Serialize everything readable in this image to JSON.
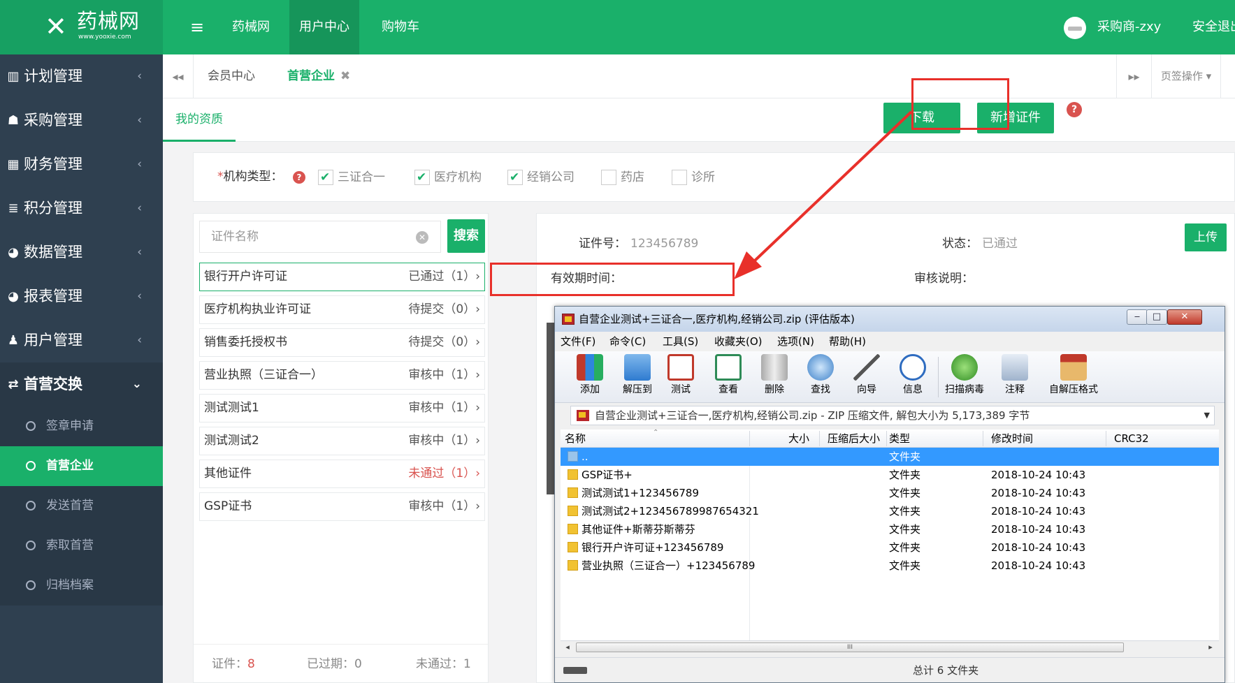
{
  "topbar": {
    "logo_mark": "✕",
    "logo_name": "药械网",
    "logo_url": "www.yooxie.com",
    "menu_icon": "hamburger-icon",
    "nav": [
      "药械网",
      "用户中心",
      "购物车"
    ],
    "user": "采购商-zxy",
    "logout": "安全退出"
  },
  "sidebar": {
    "items": [
      {
        "label": "计划管理",
        "icon": "bar-chart-icon"
      },
      {
        "label": "采购管理",
        "icon": "shopping-icon"
      },
      {
        "label": "财务管理",
        "icon": "calculator-icon"
      },
      {
        "label": "积分管理",
        "icon": "database-icon"
      },
      {
        "label": "数据管理",
        "icon": "pie-chart-icon"
      },
      {
        "label": "报表管理",
        "icon": "pie-chart-icon"
      },
      {
        "label": "用户管理",
        "icon": "user-icon"
      }
    ],
    "active_parent": {
      "label": "首营交换",
      "icon": "exchange-icon"
    },
    "submenu": [
      "签章申请",
      "首营企业",
      "发送首营",
      "索取首营",
      "归档档案"
    ],
    "submenu_active_index": 1
  },
  "tabs": {
    "items": [
      "会员中心",
      "首营企业"
    ],
    "close_glyph": "✖",
    "ops": "页签操作 ▾"
  },
  "subtab": "我的资质",
  "buttons": {
    "download": "下载",
    "new_cert": "新增证件",
    "upload": "上传",
    "search": "搜索"
  },
  "org": {
    "required_mark": "*",
    "label": "机构类型：",
    "options": [
      {
        "label": "三证合一",
        "checked": true
      },
      {
        "label": "医疗机构",
        "checked": true
      },
      {
        "label": "经销公司",
        "checked": true
      },
      {
        "label": "药店",
        "checked": false
      },
      {
        "label": "诊所",
        "checked": false
      }
    ]
  },
  "search": {
    "placeholder": "证件名称"
  },
  "certs": [
    {
      "name": "银行开户许可证",
      "status": "已通过（1）›"
    },
    {
      "name": "医疗机构执业许可证",
      "status": "待提交（0）›"
    },
    {
      "name": "销售委托授权书",
      "status": "待提交（0）›"
    },
    {
      "name": "营业执照（三证合一）",
      "status": "审核中（1）›"
    },
    {
      "name": "测试测试1",
      "status": "审核中（1）›"
    },
    {
      "name": "测试测试2",
      "status": "审核中（1）›"
    },
    {
      "name": "其他证件",
      "status": "未通过（1）›"
    },
    {
      "name": "GSP证书",
      "status": "审核中（1）›"
    }
  ],
  "footer": {
    "cert_label": "证件：",
    "cert_value": "8",
    "expired_label": "已过期：",
    "expired_value": "0",
    "failed_label": "未通过：",
    "failed_value": "1"
  },
  "detail": {
    "cert_no_label": "证件号：",
    "cert_no": "123456789",
    "status_label": "状态：",
    "status": "已通过",
    "valid_label": "有效期时间：",
    "review_label": "审核说明："
  },
  "zip": {
    "title": "自营企业测试+三证合一,医疗机构,经销公司.zip (评估版本)",
    "window_buttons": [
      "‒",
      "□",
      "✕"
    ],
    "menu": [
      "文件(F)",
      "命令(C)",
      "工具(S)",
      "收藏夹(O)",
      "选项(N)",
      "帮助(H)"
    ],
    "toolbar": [
      {
        "label": "添加",
        "icon": "add-archive-icon"
      },
      {
        "label": "解压到",
        "icon": "extract-folder-icon"
      },
      {
        "label": "测试",
        "icon": "test-clipboard-icon"
      },
      {
        "label": "查看",
        "icon": "view-book-icon"
      },
      {
        "label": "删除",
        "icon": "trash-icon"
      },
      {
        "label": "查找",
        "icon": "magnifier-icon"
      },
      {
        "label": "向导",
        "icon": "wizard-wand-icon"
      },
      {
        "label": "信息",
        "icon": "info-icon"
      },
      {
        "label": "扫描病毒",
        "icon": "virus-scan-icon"
      },
      {
        "label": "注释",
        "icon": "comment-icon"
      },
      {
        "label": "自解压格式",
        "icon": "sfx-box-icon"
      }
    ],
    "address": "自营企业测试+三证合一,医疗机构,经销公司.zip - ZIP 压缩文件, 解包大小为 5,173,389 字节",
    "headers": [
      "名称",
      "大小",
      "压缩后大小",
      "类型",
      "修改时间",
      "CRC32"
    ],
    "rows": [
      {
        "name": "..",
        "type": "文件夹",
        "time": ""
      },
      {
        "name": "GSP证书+",
        "type": "文件夹",
        "time": "2018-10-24 10:43"
      },
      {
        "name": "测试测试1+123456789",
        "type": "文件夹",
        "time": "2018-10-24 10:43"
      },
      {
        "name": "测试测试2+123456789987654321",
        "type": "文件夹",
        "time": "2018-10-24 10:43"
      },
      {
        "name": "其他证件+斯蒂芬斯蒂芬",
        "type": "文件夹",
        "time": "2018-10-24 10:43"
      },
      {
        "name": "银行开户许可证+123456789",
        "type": "文件夹",
        "time": "2018-10-24 10:43"
      },
      {
        "name": "营业执照（三证合一）+123456789",
        "type": "文件夹",
        "time": "2018-10-24 10:43"
      }
    ],
    "scroll_grip": "III",
    "status": "总计 6 文件夹"
  },
  "colors": {
    "brand": "#1ab06a",
    "sidebar": "#2f4050",
    "annotation": "#e8302a",
    "error": "#d9534f"
  }
}
